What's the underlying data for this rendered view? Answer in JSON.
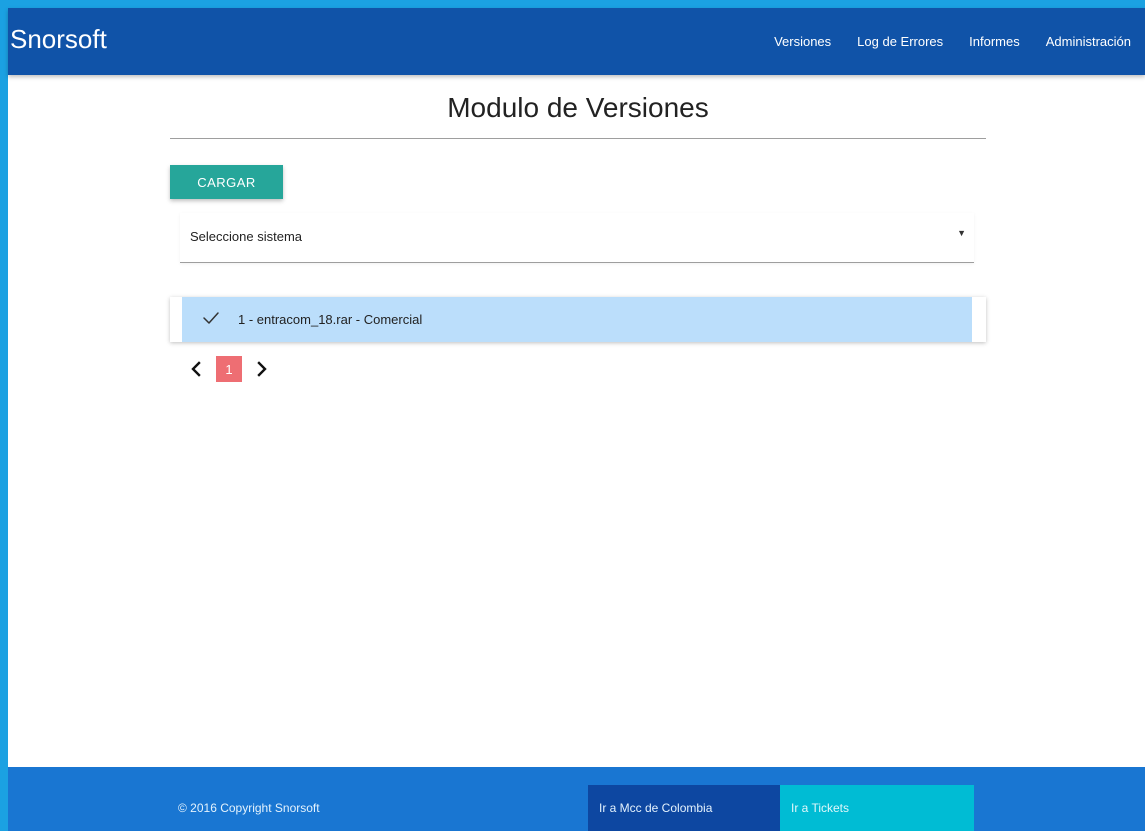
{
  "navbar": {
    "brand": "Snorsoft",
    "links": [
      "Versiones",
      "Log de Errores",
      "Informes",
      "Administración"
    ]
  },
  "main": {
    "title": "Modulo de Versiones",
    "upload_button": "CARGAR",
    "system_select": {
      "selected": "Seleccione sistema"
    },
    "versions_list": [
      {
        "label": "1 - entracom_18.rar - Comercial",
        "checked": true
      }
    ],
    "pagination": {
      "current_page": "1"
    }
  },
  "footer": {
    "copyright": "© 2016 Copyright Snorsoft",
    "link_mcc": "Ir a Mcc de Colombia",
    "link_tickets": "Ir a Tickets"
  },
  "colors": {
    "frame_border": "#1ba1e2",
    "navbar": "#1053a8",
    "button": "#26a69a",
    "list_item_selected": "#bbdefb",
    "active_page": "#ee6e73",
    "footer": "#1976d2",
    "footer_link_dark": "#0d47a1",
    "footer_link_light": "#00bcd4"
  },
  "icons": {
    "list_item": "check-icon",
    "prev": "chevron-left-icon",
    "next": "chevron-right-icon",
    "select": "caret-down-icon"
  }
}
